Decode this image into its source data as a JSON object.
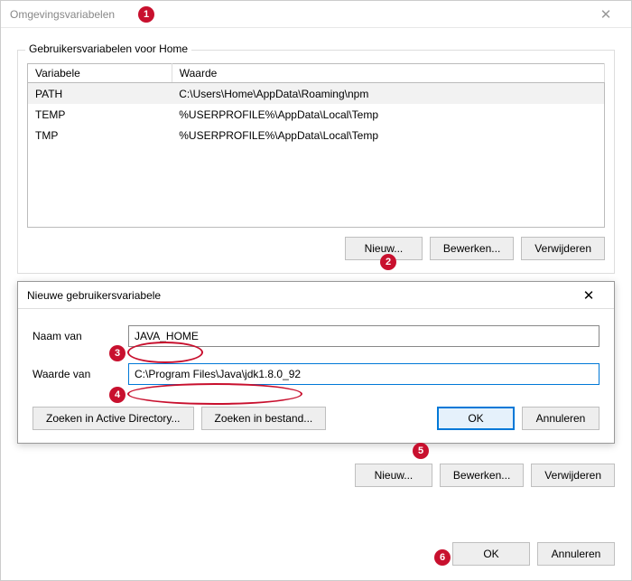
{
  "window": {
    "title": "Omgevingsvariabelen"
  },
  "user_section": {
    "title": "Gebruikersvariabelen voor Home",
    "headers": {
      "var": "Variabele",
      "val": "Waarde"
    },
    "rows": [
      {
        "var": "PATH",
        "val": "C:\\Users\\Home\\AppData\\Roaming\\npm"
      },
      {
        "var": "TEMP",
        "val": "%USERPROFILE%\\AppData\\Local\\Temp"
      },
      {
        "var": "TMP",
        "val": "%USERPROFILE%\\AppData\\Local\\Temp"
      }
    ],
    "buttons": {
      "new": "Nieuw...",
      "edit": "Bewerken...",
      "delete": "Verwijderen"
    }
  },
  "modal": {
    "title": "Nieuwe gebruikersvariabele",
    "name_label": "Naam van",
    "name_value": "JAVA_HOME",
    "value_label": "Waarde van",
    "value_value": "C:\\Program Files\\Java\\jdk1.8.0_92",
    "browse_dir": "Zoeken in Active Directory...",
    "browse_file": "Zoeken in bestand...",
    "ok": "OK",
    "cancel": "Annuleren"
  },
  "system_section": {
    "buttons": {
      "new": "Nieuw...",
      "edit": "Bewerken...",
      "delete": "Verwijderen"
    }
  },
  "footer": {
    "ok": "OK",
    "cancel": "Annuleren"
  },
  "annots": {
    "a1": "1",
    "a2": "2",
    "a3": "3",
    "a4": "4",
    "a5": "5",
    "a6": "6"
  }
}
